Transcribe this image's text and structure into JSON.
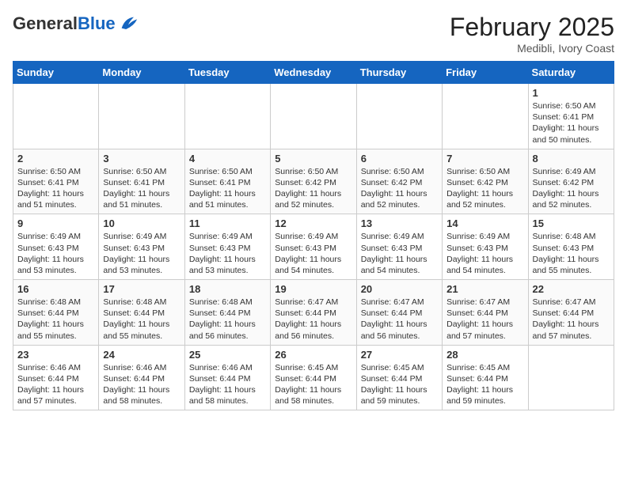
{
  "logo": {
    "general": "General",
    "blue": "Blue"
  },
  "header": {
    "month": "February 2025",
    "location": "Medibli, Ivory Coast"
  },
  "days_of_week": [
    "Sunday",
    "Monday",
    "Tuesday",
    "Wednesday",
    "Thursday",
    "Friday",
    "Saturday"
  ],
  "weeks": [
    [
      {
        "day": "",
        "info": ""
      },
      {
        "day": "",
        "info": ""
      },
      {
        "day": "",
        "info": ""
      },
      {
        "day": "",
        "info": ""
      },
      {
        "day": "",
        "info": ""
      },
      {
        "day": "",
        "info": ""
      },
      {
        "day": "1",
        "info": "Sunrise: 6:50 AM\nSunset: 6:41 PM\nDaylight: 11 hours\nand 50 minutes."
      }
    ],
    [
      {
        "day": "2",
        "info": "Sunrise: 6:50 AM\nSunset: 6:41 PM\nDaylight: 11 hours\nand 51 minutes."
      },
      {
        "day": "3",
        "info": "Sunrise: 6:50 AM\nSunset: 6:41 PM\nDaylight: 11 hours\nand 51 minutes."
      },
      {
        "day": "4",
        "info": "Sunrise: 6:50 AM\nSunset: 6:41 PM\nDaylight: 11 hours\nand 51 minutes."
      },
      {
        "day": "5",
        "info": "Sunrise: 6:50 AM\nSunset: 6:42 PM\nDaylight: 11 hours\nand 52 minutes."
      },
      {
        "day": "6",
        "info": "Sunrise: 6:50 AM\nSunset: 6:42 PM\nDaylight: 11 hours\nand 52 minutes."
      },
      {
        "day": "7",
        "info": "Sunrise: 6:50 AM\nSunset: 6:42 PM\nDaylight: 11 hours\nand 52 minutes."
      },
      {
        "day": "8",
        "info": "Sunrise: 6:49 AM\nSunset: 6:42 PM\nDaylight: 11 hours\nand 52 minutes."
      }
    ],
    [
      {
        "day": "9",
        "info": "Sunrise: 6:49 AM\nSunset: 6:43 PM\nDaylight: 11 hours\nand 53 minutes."
      },
      {
        "day": "10",
        "info": "Sunrise: 6:49 AM\nSunset: 6:43 PM\nDaylight: 11 hours\nand 53 minutes."
      },
      {
        "day": "11",
        "info": "Sunrise: 6:49 AM\nSunset: 6:43 PM\nDaylight: 11 hours\nand 53 minutes."
      },
      {
        "day": "12",
        "info": "Sunrise: 6:49 AM\nSunset: 6:43 PM\nDaylight: 11 hours\nand 54 minutes."
      },
      {
        "day": "13",
        "info": "Sunrise: 6:49 AM\nSunset: 6:43 PM\nDaylight: 11 hours\nand 54 minutes."
      },
      {
        "day": "14",
        "info": "Sunrise: 6:49 AM\nSunset: 6:43 PM\nDaylight: 11 hours\nand 54 minutes."
      },
      {
        "day": "15",
        "info": "Sunrise: 6:48 AM\nSunset: 6:43 PM\nDaylight: 11 hours\nand 55 minutes."
      }
    ],
    [
      {
        "day": "16",
        "info": "Sunrise: 6:48 AM\nSunset: 6:44 PM\nDaylight: 11 hours\nand 55 minutes."
      },
      {
        "day": "17",
        "info": "Sunrise: 6:48 AM\nSunset: 6:44 PM\nDaylight: 11 hours\nand 55 minutes."
      },
      {
        "day": "18",
        "info": "Sunrise: 6:48 AM\nSunset: 6:44 PM\nDaylight: 11 hours\nand 56 minutes."
      },
      {
        "day": "19",
        "info": "Sunrise: 6:47 AM\nSunset: 6:44 PM\nDaylight: 11 hours\nand 56 minutes."
      },
      {
        "day": "20",
        "info": "Sunrise: 6:47 AM\nSunset: 6:44 PM\nDaylight: 11 hours\nand 56 minutes."
      },
      {
        "day": "21",
        "info": "Sunrise: 6:47 AM\nSunset: 6:44 PM\nDaylight: 11 hours\nand 57 minutes."
      },
      {
        "day": "22",
        "info": "Sunrise: 6:47 AM\nSunset: 6:44 PM\nDaylight: 11 hours\nand 57 minutes."
      }
    ],
    [
      {
        "day": "23",
        "info": "Sunrise: 6:46 AM\nSunset: 6:44 PM\nDaylight: 11 hours\nand 57 minutes."
      },
      {
        "day": "24",
        "info": "Sunrise: 6:46 AM\nSunset: 6:44 PM\nDaylight: 11 hours\nand 58 minutes."
      },
      {
        "day": "25",
        "info": "Sunrise: 6:46 AM\nSunset: 6:44 PM\nDaylight: 11 hours\nand 58 minutes."
      },
      {
        "day": "26",
        "info": "Sunrise: 6:45 AM\nSunset: 6:44 PM\nDaylight: 11 hours\nand 58 minutes."
      },
      {
        "day": "27",
        "info": "Sunrise: 6:45 AM\nSunset: 6:44 PM\nDaylight: 11 hours\nand 59 minutes."
      },
      {
        "day": "28",
        "info": "Sunrise: 6:45 AM\nSunset: 6:44 PM\nDaylight: 11 hours\nand 59 minutes."
      },
      {
        "day": "",
        "info": ""
      }
    ]
  ]
}
